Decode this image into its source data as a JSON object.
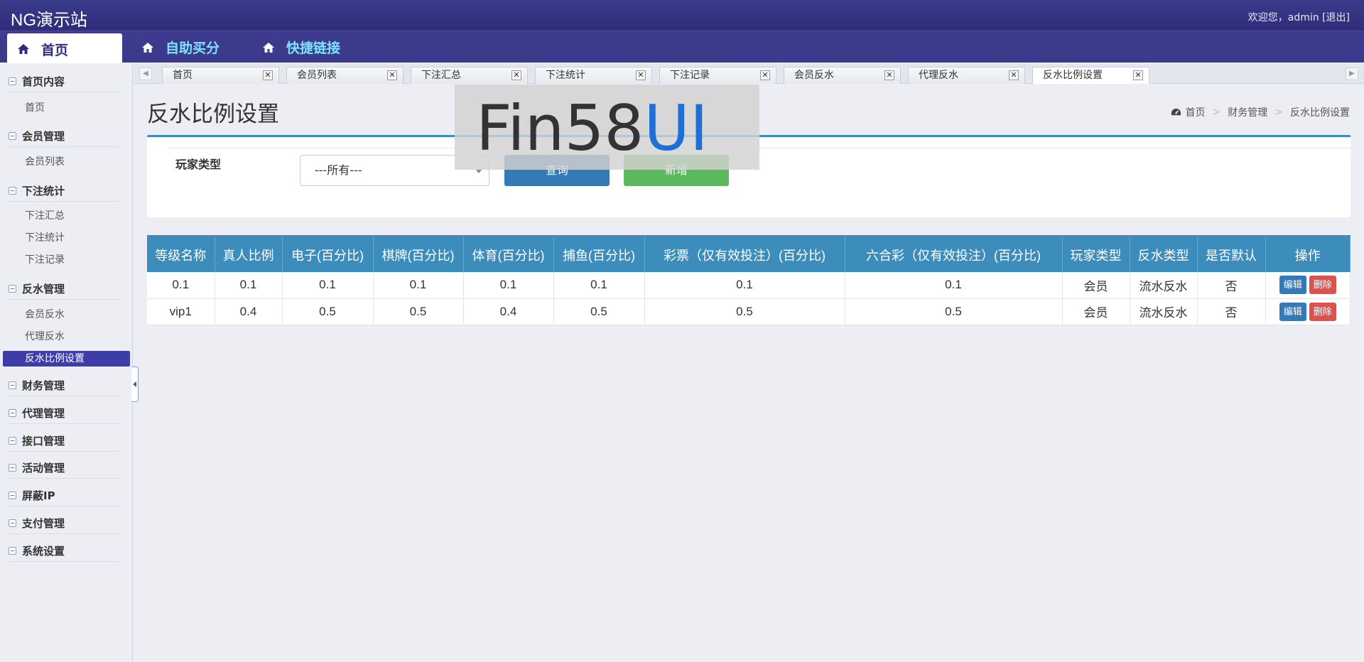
{
  "header": {
    "site_title": "NG演示站",
    "welcome_prefix": "欢迎您，admin",
    "logout": "[退出]"
  },
  "nav": {
    "tabs": [
      {
        "label": "首页"
      },
      {
        "label": "自助买分"
      },
      {
        "label": "快捷链接"
      }
    ]
  },
  "sidebar": {
    "groups": [
      {
        "label": "首页内容",
        "items": [
          "首页"
        ]
      },
      {
        "label": "会员管理",
        "items": [
          "会员列表"
        ]
      },
      {
        "label": "下注统计",
        "items": [
          "下注汇总",
          "下注统计",
          "下注记录"
        ]
      },
      {
        "label": "反水管理",
        "items": [
          "会员反水",
          "代理反水",
          "反水比例设置"
        ]
      },
      {
        "label": "财务管理",
        "items": []
      },
      {
        "label": "代理管理",
        "items": []
      },
      {
        "label": "接口管理",
        "items": []
      },
      {
        "label": "活动管理",
        "items": []
      },
      {
        "label": "屏蔽IP",
        "items": []
      },
      {
        "label": "支付管理",
        "items": []
      },
      {
        "label": "系统设置",
        "items": []
      }
    ],
    "active_item": "反水比例设置"
  },
  "tabs": [
    "首页",
    "会员列表",
    "下注汇总",
    "下注统计",
    "下注记录",
    "会员反水",
    "代理反水",
    "反水比例设置"
  ],
  "active_tab": "反水比例设置",
  "page": {
    "title": "反水比例设置",
    "breadcrumb": [
      "首页",
      "财务管理",
      "反水比例设置"
    ]
  },
  "filter": {
    "label": "玩家类型",
    "select_value": "---所有---",
    "query_button": "查询",
    "add_button": "新增"
  },
  "watermark": {
    "text_dark": "Fin58",
    "text_blue": "UI"
  },
  "table": {
    "headers": [
      "等级名称",
      "真人比例",
      "电子(百分比)",
      "棋牌(百分比)",
      "体育(百分比)",
      "捕鱼(百分比)",
      "彩票（仅有效投注）(百分比)",
      "六合彩（仅有效投注）(百分比)",
      "玩家类型",
      "反水类型",
      "是否默认",
      "操作"
    ],
    "rows": [
      [
        "0.1",
        "0.1",
        "0.1",
        "0.1",
        "0.1",
        "0.1",
        "0.1",
        "0.1",
        "会员",
        "流水反水",
        "否"
      ],
      [
        "vip1",
        "0.4",
        "0.5",
        "0.5",
        "0.4",
        "0.5",
        "0.5",
        "0.5",
        "会员",
        "流水反水",
        "否"
      ]
    ],
    "edit_label": "编辑",
    "delete_label": "删除"
  },
  "colors": {
    "primary": "#3c8dbc",
    "header_bg": "#2f2d7a",
    "active_side": "#3d3da8",
    "success": "#5cb85c",
    "danger": "#d9534f"
  }
}
